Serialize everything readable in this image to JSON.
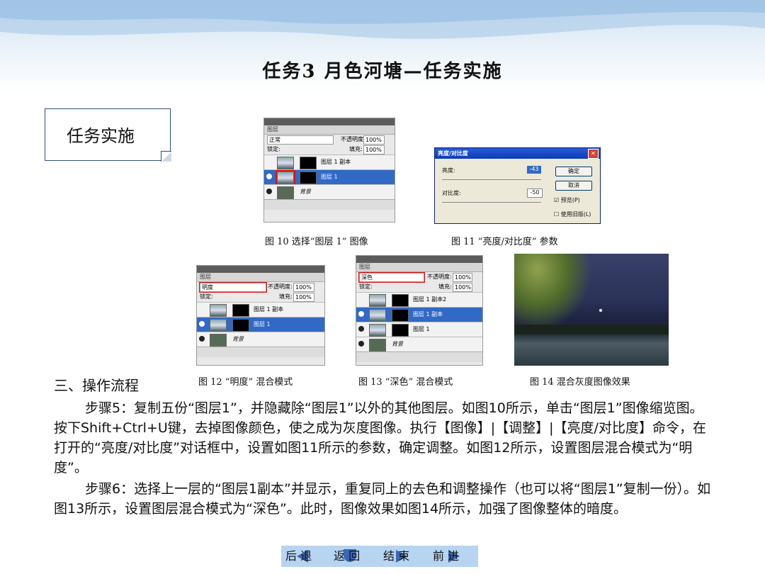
{
  "title": "任务3   月色河塘—任务实施",
  "callout": "任务实施",
  "panel_common": {
    "tab": "图层",
    "opacity_label": "不透明度:",
    "opacity_value": "100%",
    "lock_label": "锁定:",
    "fill_label": "填充:",
    "fill_value": "100%",
    "layer_copy1": "图层 1 副本",
    "layer_copy2": "图层 1 副本2",
    "layer_1": "图层 1",
    "layer_bg": "背景"
  },
  "fig10": {
    "blend": "正常",
    "caption": "图 10   选择“图层 1” 图像"
  },
  "fig11": {
    "caption": "图 11   “亮度/对比度” 参数",
    "dialog_title": "亮度/对比度",
    "brightness_label": "亮度:",
    "brightness_value": "-43",
    "contrast_label": "对比度:",
    "contrast_value": "-50",
    "ok": "确定",
    "cancel": "取消",
    "preview": "预览(P)",
    "legacy": "使用旧版(L)"
  },
  "fig12": {
    "blend": "明度",
    "caption": "图 12  “明度” 混合模式"
  },
  "fig13": {
    "blend": "深色",
    "caption": "图 13  “深色” 混合模式"
  },
  "fig14": {
    "caption": "图 14  混合灰度图像效果"
  },
  "section": "三、操作流程",
  "para1": "步骤5：复制五份“图层1”，并隐藏除“图层1”以外的其他图层。如图10所示，单击“图层1”图像缩览图。按下Shift+Ctrl+U键，去掉图像颜色，使之成为灰度图像。执行【图像】|【调整】|【亮度/对比度】命令，在打开的“亮度/对比度”对话框中，设置如图11所示的参数，确定调整。如图12所示，设置图层混合模式为“明度”。",
  "para2": "步骤6：选择上一层的“图层1副本”并显示，重复同上的去色和调整操作（也可以将“图层1”复制一份）。如图13所示，设置图层混合模式为“深色”。此时，图像效果如图14所示，加强了图像整体的暗度。",
  "nav": {
    "back": "后  退",
    "return": "返  回",
    "end": "结  束",
    "forward": "前  进"
  }
}
